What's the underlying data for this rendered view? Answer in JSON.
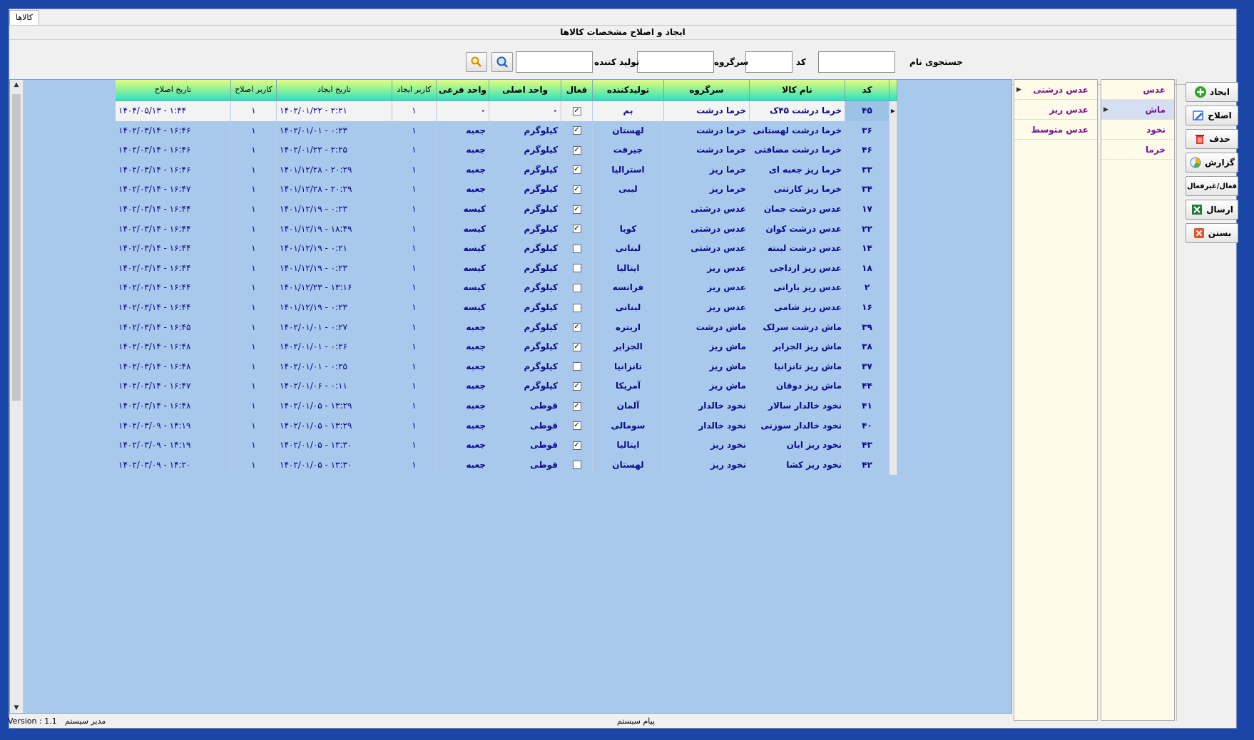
{
  "tab": {
    "label": "کالاها"
  },
  "form_title": "ایجاد و اصلاح مشخصات کالاها",
  "search": {
    "name_label": "جستجوی نام",
    "code_label": "کد",
    "group_label": "سرگروه",
    "producer_label": "تولید کننده",
    "name_value": "",
    "code_value": "",
    "group_value": "",
    "producer_value": ""
  },
  "toolbar": {
    "create": "ایجاد",
    "edit": "اصلاح",
    "delete": "حذف",
    "report": "گزارش",
    "toggle": "فعال/غیرفعال",
    "send": "ارسال",
    "close": "بستن"
  },
  "categories": [
    "عدس",
    "ماش",
    "نخود",
    "خرما"
  ],
  "subcategories": [
    "عدس درشتی",
    "عدس ریز",
    "عدس متوسط"
  ],
  "columns": {
    "code": "کد",
    "name": "نام کالا",
    "group": "سرگروه",
    "producer": "تولیدکننده",
    "active": "فعال",
    "main_unit": "واحد اصلی",
    "sub_unit": "واحد فرعی",
    "created_by": "کاربر ایجاد",
    "created_at": "تاریخ ایجاد",
    "edited_by": "کاربر اصلاح",
    "edited_at": "تاریخ اصلاح"
  },
  "rows": [
    {
      "code": "۴۵",
      "name": "خرما درشت ۴۵ک",
      "group": "خرما درشت",
      "producer": "بم",
      "active": true,
      "main_unit": "۰",
      "sub_unit": "۰",
      "created_by": "۱",
      "created_at": "۱۴۰۲/۰۱/۲۲ - ۲:۲۱",
      "edited_by": "۱",
      "edited_at": "۱۴۰۴/۰۵/۱۳ - ۱:۴۴"
    },
    {
      "code": "۳۶",
      "name": "خرما درشت لهستانی",
      "group": "خرما درشت",
      "producer": "لهستان",
      "active": true,
      "main_unit": "کیلوگرم",
      "sub_unit": "جعبه",
      "created_by": "۱",
      "created_at": "۱۴۰۲/۰۱/۰۱ - ۰:۲۳",
      "edited_by": "۱",
      "edited_at": "۱۴۰۲/۰۳/۱۴ - ۱۶:۴۶"
    },
    {
      "code": "۴۶",
      "name": "خرما درشت مضافتی",
      "group": "خرما درشت",
      "producer": "جیرفت",
      "active": true,
      "main_unit": "کیلوگرم",
      "sub_unit": "جعبه",
      "created_by": "۱",
      "created_at": "۱۴۰۲/۰۱/۲۲ - ۲:۲۵",
      "edited_by": "۱",
      "edited_at": "۱۴۰۲/۰۳/۱۴ - ۱۶:۴۶"
    },
    {
      "code": "۳۳",
      "name": "خرما ریز جعبه ای",
      "group": "خرما ریز",
      "producer": "استرالیا",
      "active": true,
      "main_unit": "کیلوگرم",
      "sub_unit": "جعبه",
      "created_by": "۱",
      "created_at": "۱۴۰۱/۱۲/۲۸ - ۲۰:۲۹",
      "edited_by": "۱",
      "edited_at": "۱۴۰۲/۰۳/۱۴ - ۱۶:۴۶"
    },
    {
      "code": "۳۴",
      "name": "خرما ریز کارتنی",
      "group": "خرما ریز",
      "producer": "لیبی",
      "active": true,
      "main_unit": "کیلوگرم",
      "sub_unit": "جعبه",
      "created_by": "۱",
      "created_at": "۱۴۰۱/۱۲/۲۸ - ۲۰:۲۹",
      "edited_by": "۱",
      "edited_at": "۱۴۰۲/۰۳/۱۴ - ۱۶:۴۷"
    },
    {
      "code": "۱۷",
      "name": "عدس درشت جمان",
      "group": "عدس درشتی",
      "producer": "",
      "active": true,
      "main_unit": "کیلوگرم",
      "sub_unit": "کیسه",
      "created_by": "۱",
      "created_at": "۱۴۰۱/۱۲/۱۹ - ۰:۲۳",
      "edited_by": "۱",
      "edited_at": "۱۴۰۲/۰۳/۱۴ - ۱۶:۴۴"
    },
    {
      "code": "۲۲",
      "name": "عدس درشت کوان",
      "group": "عدس درشتی",
      "producer": "کوبا",
      "active": true,
      "main_unit": "کیلوگرم",
      "sub_unit": "کیسه",
      "created_by": "۱",
      "created_at": "۱۴۰۱/۱۲/۱۹ - ۱۸:۴۹",
      "edited_by": "۱",
      "edited_at": "۱۴۰۲/۰۳/۱۴ - ۱۶:۴۴"
    },
    {
      "code": "۱۴",
      "name": "عدس درشت لبنته",
      "group": "عدس درشتی",
      "producer": "لبنانی",
      "active": false,
      "main_unit": "کیلوگرم",
      "sub_unit": "کیسه",
      "created_by": "۱",
      "created_at": "۱۴۰۱/۱۲/۱۹ - ۰:۲۱",
      "edited_by": "۱",
      "edited_at": "۱۴۰۲/۰۳/۱۴ - ۱۶:۴۴"
    },
    {
      "code": "۱۸",
      "name": "عدس ریز ارداجی",
      "group": "عدس ریز",
      "producer": "ایتالیا",
      "active": false,
      "main_unit": "کیلوگرم",
      "sub_unit": "کیسه",
      "created_by": "۱",
      "created_at": "۱۴۰۱/۱۲/۱۹ - ۰:۲۳",
      "edited_by": "۱",
      "edited_at": "۱۴۰۲/۰۳/۱۴ - ۱۶:۴۴"
    },
    {
      "code": "۲",
      "name": "عدس ریز بارانی",
      "group": "عدس ریز",
      "producer": "فرانسه",
      "active": false,
      "main_unit": "کیلوگرم",
      "sub_unit": "کیسه",
      "created_by": "۱",
      "created_at": "۱۴۰۱/۱۲/۲۳ - ۱۳:۱۶",
      "edited_by": "۱",
      "edited_at": "۱۴۰۲/۰۳/۱۴ - ۱۶:۴۴"
    },
    {
      "code": "۱۶",
      "name": "عدس ریز شامی",
      "group": "عدس ریز",
      "producer": "لبنانی",
      "active": false,
      "main_unit": "کیلوگرم",
      "sub_unit": "کیسه",
      "created_by": "۱",
      "created_at": "۱۴۰۱/۱۲/۱۹ - ۰:۲۳",
      "edited_by": "۱",
      "edited_at": "۱۴۰۲/۰۳/۱۴ - ۱۶:۴۴"
    },
    {
      "code": "۳۹",
      "name": "ماش درشت سرلک",
      "group": "ماش درشت",
      "producer": "اریتره",
      "active": true,
      "main_unit": "کیلوگرم",
      "sub_unit": "جعبه",
      "created_by": "۱",
      "created_at": "۱۴۰۲/۰۱/۰۱ - ۰:۲۷",
      "edited_by": "۱",
      "edited_at": "۱۴۰۲/۰۳/۱۴ - ۱۶:۴۵"
    },
    {
      "code": "۳۸",
      "name": "ماش ریز الجزایر",
      "group": "ماش ریز",
      "producer": "الجزایر",
      "active": true,
      "main_unit": "کیلوگرم",
      "sub_unit": "جعبه",
      "created_by": "۱",
      "created_at": "۱۴۰۲/۰۱/۰۱ - ۰:۲۶",
      "edited_by": "۱",
      "edited_at": "۱۴۰۲/۰۳/۱۴ - ۱۶:۴۸"
    },
    {
      "code": "۳۷",
      "name": "ماش ریز تانزانیا",
      "group": "ماش ریز",
      "producer": "تانزانیا",
      "active": false,
      "main_unit": "کیلوگرم",
      "sub_unit": "جعبه",
      "created_by": "۱",
      "created_at": "۱۴۰۲/۰۱/۰۱ - ۰:۲۵",
      "edited_by": "۱",
      "edited_at": "۱۴۰۲/۰۳/۱۴ - ۱۶:۴۸"
    },
    {
      "code": "۴۴",
      "name": "ماش ریز دوقان",
      "group": "ماش ریز",
      "producer": "آمریکا",
      "active": true,
      "main_unit": "کیلوگرم",
      "sub_unit": "جعبه",
      "created_by": "۱",
      "created_at": "۱۴۰۲/۰۱/۰۶ - ۰:۱۱",
      "edited_by": "۱",
      "edited_at": "۱۴۰۲/۰۳/۱۴ - ۱۶:۴۷"
    },
    {
      "code": "۴۱",
      "name": "نخود خالدار سالار",
      "group": "نخود خالدار",
      "producer": "آلمان",
      "active": true,
      "main_unit": "قوطی",
      "sub_unit": "جعبه",
      "created_by": "۱",
      "created_at": "۱۴۰۲/۰۱/۰۵ - ۱۳:۲۹",
      "edited_by": "۱",
      "edited_at": "۱۴۰۲/۰۳/۱۴ - ۱۶:۴۸"
    },
    {
      "code": "۴۰",
      "name": "نخود خالدار سوزنی",
      "group": "نخود خالدار",
      "producer": "سومالی",
      "active": true,
      "main_unit": "قوطی",
      "sub_unit": "جعبه",
      "created_by": "۱",
      "created_at": "۱۴۰۲/۰۱/۰۵ - ۱۳:۲۹",
      "edited_by": "۱",
      "edited_at": "۱۴۰۲/۰۳/۰۹ - ۱۴:۱۹"
    },
    {
      "code": "۴۳",
      "name": "نخود ریز ابان",
      "group": "نخود ریز",
      "producer": "ایتالیا",
      "active": true,
      "main_unit": "قوطی",
      "sub_unit": "جعبه",
      "created_by": "۱",
      "created_at": "۱۴۰۲/۰۱/۰۵ - ۱۳:۳۰",
      "edited_by": "۱",
      "edited_at": "۱۴۰۲/۰۳/۰۹ - ۱۴:۱۹"
    },
    {
      "code": "۴۲",
      "name": "نخود ریز کشا",
      "group": "نخود ریز",
      "producer": "لهستان",
      "active": false,
      "main_unit": "قوطی",
      "sub_unit": "جعبه",
      "created_by": "۱",
      "created_at": "۱۴۰۲/۰۱/۰۵ - ۱۳:۳۰",
      "edited_by": "۱",
      "edited_at": "۱۴۰۲/۰۳/۰۹ - ۱۴:۲۰"
    }
  ],
  "status": {
    "version": "Version : 1.1",
    "user": "مدیر سیستم",
    "message": "پیام سیستم"
  },
  "colors": {
    "background": "#1b46a8",
    "grid_bg": "#a8c8ec",
    "header_top": "#e4ff7a",
    "header_bottom": "#2ce0c4",
    "cell_text": "#0a0a8a",
    "tree_text": "#7a1690",
    "tree_bg": "#fffbea"
  }
}
